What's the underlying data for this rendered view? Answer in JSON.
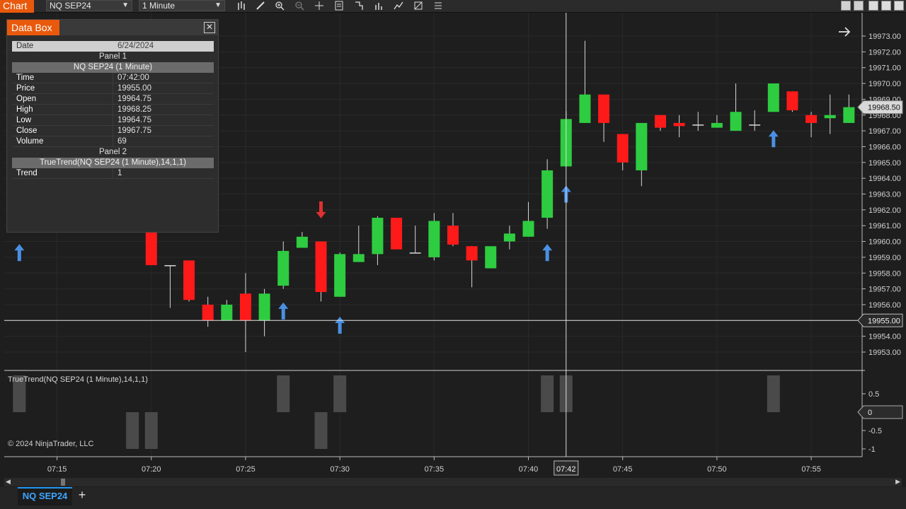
{
  "toolbar": {
    "chart_tab": "Chart",
    "instrument": "NQ SEP24",
    "interval": "1 Minute",
    "icons": [
      "bar-type-icon",
      "draw-icon",
      "zoom-in-icon",
      "zoom-out-icon",
      "crosshair-icon",
      "properties-icon",
      "strategies-icon",
      "indicators-icon",
      "chart-trader-icon",
      "templates-icon",
      "menu-icon"
    ]
  },
  "databox": {
    "title": "Data Box",
    "date_label": "Date",
    "date_value": "6/24/2024",
    "panel1_label": "Panel 1",
    "series1_label": "NQ SEP24 (1 Minute)",
    "rows": [
      {
        "k": "Time",
        "v": "07:42:00"
      },
      {
        "k": "Price",
        "v": "19955.00"
      },
      {
        "k": "Open",
        "v": "19964.75"
      },
      {
        "k": "High",
        "v": "19968.25"
      },
      {
        "k": "Low",
        "v": "19964.75"
      },
      {
        "k": "Close",
        "v": "19967.75"
      },
      {
        "k": "Volume",
        "v": "69"
      }
    ],
    "panel2_label": "Panel 2",
    "series2_label": "TrueTrend(NQ SEP24 (1 Minute),14,1,1)",
    "trend_label": "Trend",
    "trend_value": "1"
  },
  "indicator_label": "TrueTrend(NQ SEP24 (1 Minute),14,1,1)",
  "copyright": "© 2024 NinjaTrader, LLC",
  "bottom": {
    "tab_label": "NQ SEP24",
    "add_label": "+"
  },
  "colors": {
    "up": "#2ecc40",
    "down": "#ff1a1a",
    "arrow_up": "#4a90e2",
    "arrow_down": "#e03030",
    "accent": "#e8590c"
  },
  "chart_data": {
    "type": "candlestick",
    "price_axis_ticks": [
      "19973.00",
      "19972.00",
      "19971.00",
      "19970.00",
      "19969.00",
      "19968.00",
      "19967.00",
      "19966.00",
      "19965.00",
      "19964.00",
      "19963.00",
      "19962.00",
      "19961.00",
      "19960.00",
      "19959.00",
      "19958.00",
      "19957.00",
      "19956.00",
      "19955.00",
      "19954.00",
      "19953.00"
    ],
    "ylim": [
      19952.5,
      19973.3
    ],
    "current_price_label": "19968.50",
    "crosshair_price_label": "19955.00",
    "crosshair_time_label": "07:42",
    "time_ticks": [
      "07:15",
      "07:20",
      "07:25",
      "07:30",
      "07:35",
      "07:40",
      "07:45",
      "07:50",
      "07:55"
    ],
    "time_tick_minutes": [
      15,
      20,
      25,
      30,
      35,
      40,
      45,
      50,
      55
    ],
    "crosshair_minute": 42,
    "xlim_minutes": [
      12.2,
      57.7
    ],
    "candles": [
      {
        "t": 20,
        "o": 19961.0,
        "h": 19961.0,
        "l": 19958.5,
        "c": 19958.5
      },
      {
        "t": 21,
        "o": 19958.5,
        "h": 19958.5,
        "l": 19955.8,
        "c": 19958.5
      },
      {
        "t": 22,
        "o": 19958.8,
        "h": 19958.8,
        "l": 19956.2,
        "c": 19956.3
      },
      {
        "t": 23,
        "o": 19956.0,
        "h": 19956.5,
        "l": 19954.6,
        "c": 19955.0
      },
      {
        "t": 24,
        "o": 19955.0,
        "h": 19956.3,
        "l": 19955.0,
        "c": 19956.0
      },
      {
        "t": 25,
        "o": 19956.7,
        "h": 19958.0,
        "l": 19953.0,
        "c": 19955.0
      },
      {
        "t": 26,
        "o": 19955.0,
        "h": 19957.0,
        "l": 19954.0,
        "c": 19956.7
      },
      {
        "t": 27,
        "o": 19957.2,
        "h": 19960.0,
        "l": 19957.0,
        "c": 19959.4
      },
      {
        "t": 28,
        "o": 19959.6,
        "h": 19960.6,
        "l": 19959.6,
        "c": 19960.3
      },
      {
        "t": 29,
        "o": 19960.0,
        "h": 19960.0,
        "l": 19956.2,
        "c": 19956.8
      },
      {
        "t": 30,
        "o": 19956.5,
        "h": 19959.3,
        "l": 19956.5,
        "c": 19959.2
      },
      {
        "t": 31,
        "o": 19958.7,
        "h": 19961.0,
        "l": 19958.7,
        "c": 19959.2
      },
      {
        "t": 32,
        "o": 19959.2,
        "h": 19961.6,
        "l": 19958.5,
        "c": 19961.5
      },
      {
        "t": 33,
        "o": 19961.5,
        "h": 19961.5,
        "l": 19959.5,
        "c": 19959.5
      },
      {
        "t": 34,
        "o": 19959.3,
        "h": 19961.0,
        "l": 19959.3,
        "c": 19959.3
      },
      {
        "t": 35,
        "o": 19959.0,
        "h": 19961.8,
        "l": 19958.8,
        "c": 19961.3
      },
      {
        "t": 36,
        "o": 19961.0,
        "h": 19961.8,
        "l": 19959.7,
        "c": 19959.8
      },
      {
        "t": 37,
        "o": 19959.7,
        "h": 19959.7,
        "l": 19957.1,
        "c": 19958.8
      },
      {
        "t": 38,
        "o": 19958.3,
        "h": 19959.7,
        "l": 19958.3,
        "c": 19959.7
      },
      {
        "t": 39,
        "o": 19960.0,
        "h": 19961.0,
        "l": 19959.5,
        "c": 19960.5
      },
      {
        "t": 40,
        "o": 19960.3,
        "h": 19962.5,
        "l": 19960.3,
        "c": 19961.3
      },
      {
        "t": 41,
        "o": 19961.5,
        "h": 19965.2,
        "l": 19960.8,
        "c": 19964.5
      },
      {
        "t": 42,
        "o": 19964.75,
        "h": 19968.25,
        "l": 19964.75,
        "c": 19967.75
      },
      {
        "t": 43,
        "o": 19967.5,
        "h": 19972.7,
        "l": 19967.5,
        "c": 19969.3
      },
      {
        "t": 44,
        "o": 19969.3,
        "h": 19969.3,
        "l": 19966.3,
        "c": 19967.5
      },
      {
        "t": 45,
        "o": 19966.8,
        "h": 19966.8,
        "l": 19964.5,
        "c": 19965.0
      },
      {
        "t": 46,
        "o": 19964.5,
        "h": 19967.5,
        "l": 19963.5,
        "c": 19967.5
      },
      {
        "t": 47,
        "o": 19968.0,
        "h": 19968.0,
        "l": 19967.0,
        "c": 19967.2
      },
      {
        "t": 48,
        "o": 19967.5,
        "h": 19968.0,
        "l": 19966.6,
        "c": 19967.3
      },
      {
        "t": 49,
        "o": 19967.4,
        "h": 19968.2,
        "l": 19967.0,
        "c": 19967.4
      },
      {
        "t": 50,
        "o": 19967.2,
        "h": 19968.0,
        "l": 19967.2,
        "c": 19967.5
      },
      {
        "t": 51,
        "o": 19967.0,
        "h": 19970.0,
        "l": 19967.0,
        "c": 19968.2
      },
      {
        "t": 52,
        "o": 19967.4,
        "h": 19968.3,
        "l": 19967.0,
        "c": 19967.4
      },
      {
        "t": 53,
        "o": 19968.2,
        "h": 19970.0,
        "l": 19968.2,
        "c": 19970.0
      },
      {
        "t": 54,
        "o": 19969.5,
        "h": 19969.5,
        "l": 19968.2,
        "c": 19968.3
      },
      {
        "t": 55,
        "o": 19968.0,
        "h": 19968.2,
        "l": 19966.6,
        "c": 19967.5
      },
      {
        "t": 56,
        "o": 19967.8,
        "h": 19969.3,
        "l": 19966.8,
        "c": 19968.0
      },
      {
        "t": 57,
        "o": 19967.5,
        "h": 19969.3,
        "l": 19967.5,
        "c": 19968.5
      }
    ],
    "signals": [
      {
        "t": 13,
        "dir": "up",
        "price": 19959.3
      },
      {
        "t": 27,
        "dir": "up",
        "price": 19955.6
      },
      {
        "t": 29,
        "dir": "down",
        "price": 19962.0
      },
      {
        "t": 30,
        "dir": "up",
        "price": 19954.7
      },
      {
        "t": 41,
        "dir": "up",
        "price": 19959.3
      },
      {
        "t": 42,
        "dir": "up",
        "price": 19963.0
      },
      {
        "t": 53,
        "dir": "up",
        "price": 19966.5
      }
    ],
    "indicator": {
      "name": "TrueTrend(NQ SEP24 (1 Minute),14,1,1)",
      "ticks": [
        "0.5",
        "0",
        "-0.5",
        "-1"
      ],
      "ylim": [
        -1,
        1
      ],
      "zero_label": "0",
      "bars": [
        {
          "t": 13,
          "v": 1
        },
        {
          "t": 19,
          "v": -1
        },
        {
          "t": 20,
          "v": -1
        },
        {
          "t": 27,
          "v": 1
        },
        {
          "t": 29,
          "v": -1
        },
        {
          "t": 30,
          "v": 1
        },
        {
          "t": 41,
          "v": 1
        },
        {
          "t": 42,
          "v": 1
        },
        {
          "t": 53,
          "v": 1
        }
      ]
    }
  }
}
